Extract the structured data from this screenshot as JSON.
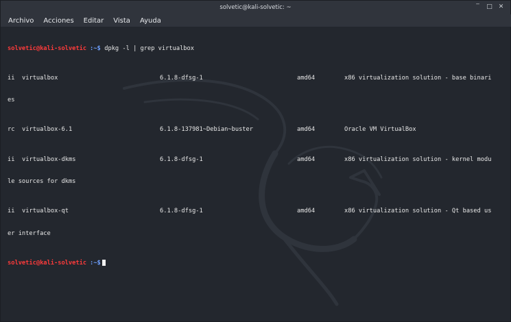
{
  "window": {
    "title": "solvetic@kali-solvetic: ~",
    "controls": {
      "minimize": "‾",
      "maximize": "□",
      "close": "✕"
    }
  },
  "menu": {
    "items": [
      "Archivo",
      "Acciones",
      "Editar",
      "Vista",
      "Ayuda"
    ]
  },
  "prompt": {
    "user": "solvetic@kali-solvetic",
    "path": ":~$",
    "command": " dpkg -l | grep virtualbox"
  },
  "output": [
    {
      "status": "ii",
      "name": "virtualbox",
      "version": "6.1.8-dfsg-1",
      "arch": "amd64",
      "desc": "x86 virtualization solution - base binari"
    },
    {
      "wrap": "es"
    },
    {
      "status": "rc",
      "name": "virtualbox-6.1",
      "version": "6.1.8-137981~Debian~buster",
      "arch": "amd64",
      "desc": "Oracle VM VirtualBox"
    },
    {
      "status": "ii",
      "name": "virtualbox-dkms",
      "version": "6.1.8-dfsg-1",
      "arch": "amd64",
      "desc": "x86 virtualization solution - kernel modu"
    },
    {
      "wrap": "le sources for dkms"
    },
    {
      "status": "ii",
      "name": "virtualbox-qt",
      "version": "6.1.8-dfsg-1",
      "arch": "amd64",
      "desc": "x86 virtualization solution - Qt based us"
    },
    {
      "wrap": "er interface"
    }
  ],
  "prompt2": {
    "user": "solvetic@kali-solvetic",
    "path": ":~$"
  },
  "colors": {
    "user": "#ff3b3b",
    "path": "#6ea0ff",
    "background": "#23272e"
  }
}
